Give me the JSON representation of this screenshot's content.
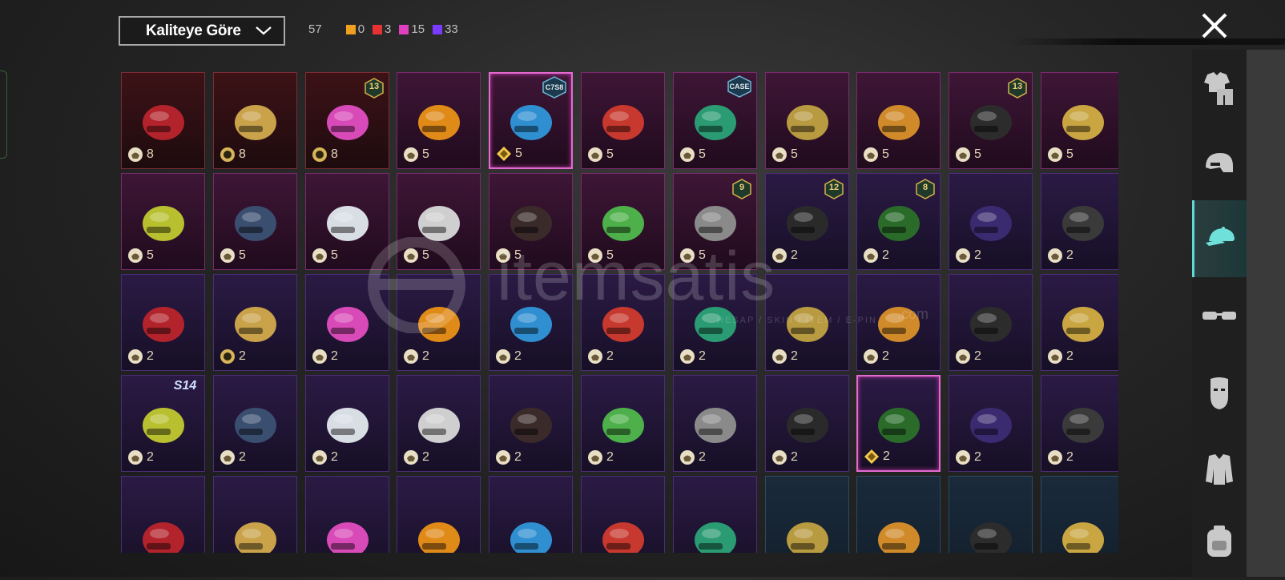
{
  "sort": {
    "label": "Kaliteye Göre"
  },
  "counts": {
    "total": "57",
    "items": [
      {
        "color": "#f0a020",
        "value": "0"
      },
      {
        "color": "#e63232",
        "value": "3"
      },
      {
        "color": "#e040c0",
        "value": "15"
      },
      {
        "color": "#7a3aff",
        "value": "33"
      }
    ]
  },
  "sidebar": [
    "outfit-icon",
    "helmet-icon",
    "cap-icon",
    "glasses-icon",
    "mask-icon",
    "jacket-icon",
    "backpack-icon"
  ],
  "watermark": {
    "text": "itemsatis",
    "sub": "HESAP / SKIN / ITEM / E-PIN",
    "domain": ".com"
  },
  "grid": {
    "rows": [
      [
        {
          "name": "red-helmet",
          "q": "red",
          "icon": "ticket",
          "count": "8"
        },
        {
          "name": "red-mask-helmet",
          "q": "red",
          "icon": "coin",
          "count": "8"
        },
        {
          "name": "pink-dreadlock-helmet",
          "q": "red",
          "icon": "coin",
          "count": "8",
          "badge": "13"
        },
        {
          "name": "pumpkin-helmet",
          "q": "pink",
          "icon": "ticket",
          "count": "5"
        },
        {
          "name": "blue-feather-helmet",
          "q": "pink",
          "icon": "gem",
          "count": "5",
          "case": "C7S8",
          "selected": true
        },
        {
          "name": "dragon-mask",
          "q": "pink",
          "icon": "ticket",
          "count": "5"
        },
        {
          "name": "green-helmet",
          "q": "pink",
          "icon": "ticket",
          "count": "5",
          "case": "CASE"
        },
        {
          "name": "gold-spiked-helmet",
          "q": "pink",
          "icon": "ticket",
          "count": "5"
        },
        {
          "name": "cat-helmet",
          "q": "pink",
          "icon": "ticket",
          "count": "5"
        },
        {
          "name": "horned-helmet",
          "q": "pink",
          "icon": "ticket",
          "count": "5",
          "badge": "13"
        },
        {
          "name": "gold-crown-helmet",
          "q": "pink",
          "icon": "ticket",
          "count": "5"
        }
      ],
      [
        {
          "name": "yellow-bucket-hat",
          "q": "pink",
          "icon": "ticket",
          "count": "5"
        },
        {
          "name": "blue-ninja-helmet",
          "q": "pink",
          "icon": "ticket",
          "count": "5"
        },
        {
          "name": "white-cat-helmet",
          "q": "pink",
          "icon": "ticket",
          "count": "5"
        },
        {
          "name": "white-dread-mask",
          "q": "pink",
          "icon": "ticket",
          "count": "5"
        },
        {
          "name": "black-bandana",
          "q": "pink",
          "icon": "ticket",
          "count": "5"
        },
        {
          "name": "frog-helmet",
          "q": "pink",
          "icon": "ticket",
          "count": "5"
        },
        {
          "name": "grey-dreadlocks",
          "q": "pink",
          "icon": "ticket",
          "count": "5",
          "badge": "9"
        },
        {
          "name": "bunny-ear-helmet",
          "q": "purple",
          "icon": "ticket",
          "count": "2",
          "badge": "12"
        },
        {
          "name": "green-skull-hood",
          "q": "purple",
          "icon": "ticket",
          "count": "2",
          "badge": "8"
        },
        {
          "name": "purple-punk-helmet",
          "q": "purple",
          "icon": "ticket",
          "count": "2"
        },
        {
          "name": "black-cap",
          "q": "purple",
          "icon": "ticket",
          "count": "2"
        }
      ],
      [
        {
          "name": "viking-helmet",
          "q": "purple",
          "icon": "ticket",
          "count": "2"
        },
        {
          "name": "white-sun-hat",
          "q": "purple",
          "icon": "coin",
          "count": "2"
        },
        {
          "name": "orange-ears",
          "q": "purple",
          "icon": "ticket",
          "count": "2"
        },
        {
          "name": "witch-hat",
          "q": "purple",
          "icon": "ticket",
          "count": "2"
        },
        {
          "name": "green-army-helmet",
          "q": "purple",
          "icon": "ticket",
          "count": "2"
        },
        {
          "name": "football-helmet",
          "q": "purple",
          "icon": "ticket",
          "count": "2"
        },
        {
          "name": "blue-baseball-helmet",
          "q": "purple",
          "icon": "ticket",
          "count": "2"
        },
        {
          "name": "pink-braid-wig",
          "q": "purple",
          "icon": "ticket",
          "count": "2"
        },
        {
          "name": "blue-cap",
          "q": "purple",
          "icon": "ticket",
          "count": "2"
        },
        {
          "name": "red-white-hat",
          "q": "purple",
          "icon": "ticket",
          "count": "2"
        },
        {
          "name": "clown-mask",
          "q": "purple",
          "icon": "ticket",
          "count": "2"
        }
      ],
      [
        {
          "name": "spartan-helmet",
          "q": "purple",
          "icon": "ticket",
          "count": "2",
          "season": "S14"
        },
        {
          "name": "black-cap-2",
          "q": "purple",
          "icon": "ticket",
          "count": "2"
        },
        {
          "name": "black-panther-mask",
          "q": "purple",
          "icon": "ticket",
          "count": "2"
        },
        {
          "name": "shark-hood-blue",
          "q": "purple",
          "icon": "ticket",
          "count": "2"
        },
        {
          "name": "red-beret",
          "q": "purple",
          "icon": "ticket",
          "count": "2"
        },
        {
          "name": "black-fedora",
          "q": "purple",
          "icon": "ticket",
          "count": "2"
        },
        {
          "name": "red-fedora",
          "q": "purple",
          "icon": "ticket",
          "count": "2"
        },
        {
          "name": "grey-shark-hood",
          "q": "purple",
          "icon": "ticket",
          "count": "2"
        },
        {
          "name": "flower-crown",
          "q": "purple",
          "icon": "gem",
          "count": "2",
          "selected": true
        },
        {
          "name": "knit-beanie",
          "q": "purple",
          "icon": "ticket",
          "count": "2"
        },
        {
          "name": "burger-hat",
          "q": "purple",
          "icon": "ticket",
          "count": "2"
        }
      ],
      [
        {
          "name": "headlamp",
          "q": "purple"
        },
        {
          "name": "blue-beanie",
          "q": "purple"
        },
        {
          "name": "black-gold-cap",
          "q": "purple"
        },
        {
          "name": "blue-cap-2",
          "q": "purple"
        },
        {
          "name": "brown-fedora",
          "q": "purple"
        },
        {
          "name": "bucket-hat-black",
          "q": "purple"
        },
        {
          "name": "aviator-cap",
          "q": "purple"
        },
        {
          "name": "blue-beret",
          "q": "blue"
        },
        {
          "name": "grey-flat-cap",
          "q": "blue"
        },
        {
          "name": "tan-trucker-cap",
          "q": "blue"
        },
        {
          "name": "tan-trucker-cap-2",
          "q": "blue"
        }
      ]
    ]
  }
}
